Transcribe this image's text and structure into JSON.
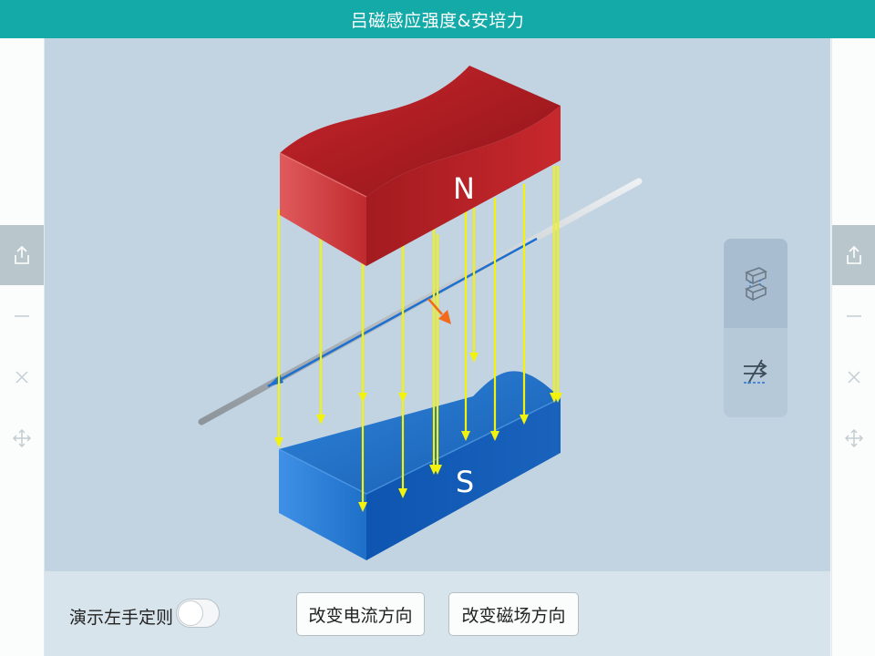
{
  "window": {
    "title": "吕磁感应强度&安培力"
  },
  "magnet": {
    "north_label": "N",
    "south_label": "S"
  },
  "controls": {
    "left_hand_rule_label": "演示左手定则",
    "left_hand_rule_on": false,
    "reverse_current_label": "改变电流方向",
    "reverse_field_label": "改变磁场方向"
  },
  "toolpanel": {
    "items": [
      {
        "icon": "magnet-block-icon",
        "selected": true
      },
      {
        "icon": "field-lines-icon",
        "selected": false
      }
    ]
  },
  "sidebar_tools": [
    "share-icon",
    "minimize-icon",
    "close-icon",
    "move-icon"
  ],
  "colors": {
    "title_bar": "#14aaa8",
    "stage": "#c2d4e2",
    "north_pole": "#c8262c",
    "south_pole": "#1e6fc8",
    "field_lines": "#f2f20c",
    "force_arrow": "#f26a1b",
    "current": "#1d6fd0"
  }
}
